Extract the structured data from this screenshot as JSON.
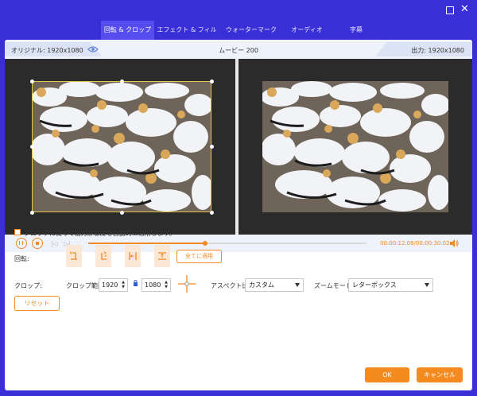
{
  "tabs": [
    {
      "label": "回転 & クロップ",
      "active": true
    },
    {
      "label": "エフェクト & フィルター",
      "active": false
    },
    {
      "label": "ウォーターマーク",
      "active": false
    },
    {
      "label": "オーディオ",
      "active": false
    },
    {
      "label": "字幕",
      "active": false
    }
  ],
  "header": {
    "original_label": "オリジナル: 1920x1080",
    "movie_name": "ムービー 200",
    "output_label": "出力: 1920x1080"
  },
  "playback": {
    "current_time": "00:00:12.09",
    "separator": "/",
    "duration": "00:00:30.02",
    "progress": 0.42
  },
  "settings": {
    "auto_apply_label": "クロップに従って出力解像度を自動的に適用します。",
    "rotation_label": "回転:",
    "apply_all_label": "全てに適用",
    "crop_label": "クロップ:",
    "crop_range_label": "クロップ範囲:",
    "crop_width": "1920",
    "crop_height": "1080",
    "aspect_label": "アスペクト比:",
    "aspect_value": "カスタム",
    "zoom_label": "ズームモード:",
    "zoom_value": "レターボックス",
    "reset_label": "リセット"
  },
  "footer": {
    "ok_label": "OK",
    "cancel_label": "キャンセル"
  },
  "colors": {
    "accent": "#f08a24",
    "window_bg": "#3a2fd6",
    "active_tab": "#574dee"
  }
}
